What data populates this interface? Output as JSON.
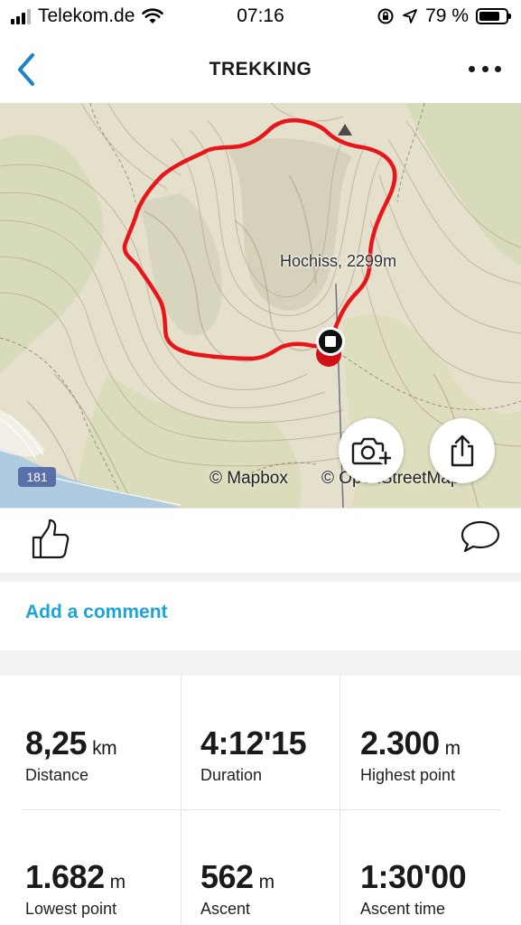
{
  "status_bar": {
    "carrier": "Telekom.de",
    "time": "07:16",
    "battery": "79 %"
  },
  "nav": {
    "title": "TREKKING"
  },
  "map": {
    "peak_label": "Hochiss, 2299m",
    "attribution_mapbox": "© Mapbox",
    "attribution_osm": "© OpenStreetMap",
    "road_badge": "181",
    "route_color": "#e8151b"
  },
  "actions": {
    "add_comment": "Add a comment"
  },
  "stats": [
    {
      "value": "8,25",
      "unit": "km",
      "label": "Distance"
    },
    {
      "value": "4:12'15",
      "unit": "",
      "label": "Duration"
    },
    {
      "value": "2.300",
      "unit": "m",
      "label": "Highest point"
    },
    {
      "value": "1.682",
      "unit": "m",
      "label": "Lowest point"
    },
    {
      "value": "562",
      "unit": "m",
      "label": "Ascent"
    },
    {
      "value": "1:30'00",
      "unit": "",
      "label": "Ascent time"
    }
  ],
  "colors": {
    "accent": "#1ba5d8",
    "route": "#e8151b"
  }
}
